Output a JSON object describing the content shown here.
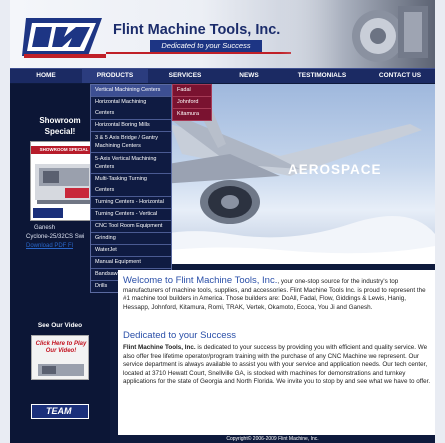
{
  "header": {
    "company_name": "Flint Machine Tools, Inc.",
    "tagline": "Dedicated to your Success"
  },
  "nav": {
    "items": [
      "HOME",
      "PRODUCTS",
      "SERVICES",
      "NEWS",
      "TESTIMONIALS",
      "CONTACT US"
    ]
  },
  "products_menu": [
    "Vertical Machining Centers",
    "Horizontal Machining Centers",
    "Horizontal Boring Mills",
    "3 & 5 Axis Bridge / Gantry Machining Centers",
    "5-Axis Vertical Machining Centers",
    "Multi-Tasking Turning Centers",
    "Turning Centers - Horizontal",
    "Turning Centers - Vertical",
    "CNC Tool Room Equipment",
    "Grinding",
    "WaterJet",
    "Manual Equipment",
    "Bandsaws",
    "Drills"
  ],
  "vmc_submenu": [
    "Fadal",
    "Johnford",
    "Kitamura"
  ],
  "sidebar": {
    "showroom_title": "Showroom Special!",
    "flyer_banner": "SHOWROOM SPECIAL",
    "caption_line1": "Ganesh",
    "caption_line2": "Cyclone-25/32CS Swi",
    "caption_link": "Download PDF Fl",
    "video_title": "See Our Video",
    "video_text": "Click Here to Play Our Video!",
    "team_label": "TEAM"
  },
  "hero": {
    "title": "AEROSPACE"
  },
  "welcome": {
    "heading": "Welcome to Flint Machine Tools, Inc.",
    "intro": ", your one-stop source for the industry's top manufacturers of machine tools, supplies, and accessories. Flint Machine Tools Inc. is proud to represent the #1 machine tool builders in America. Those builders are: DoAll, Fadal, Flow, Giddings & Lewis, Hanig, Hessapp, Johnford, Kitamura, Romi, TRAK, Vertek, Okamoto, Ecoca, You Ji and Ganesh."
  },
  "dedicated": {
    "heading": "Dedicated to your Success",
    "company": "Flint Machine Tools, Inc.",
    "body": " is dedicated to your success by providing you with efficient and quality service. We also offer free lifetime operator/program training with the purchase of any CNC Machine we represent. Our service department is always available to assist you with your service and application needs. Our tech center, located at 3710 Hewatt Court, Snellville GA, is stocked with machines for demonstrations and turnkey applications for the state of Georgia and North Florida. We invite you to stop by and see what we have to offer."
  },
  "footer": {
    "copyright": "Copyright© 2006-2009 Flint Machine, Inc."
  }
}
